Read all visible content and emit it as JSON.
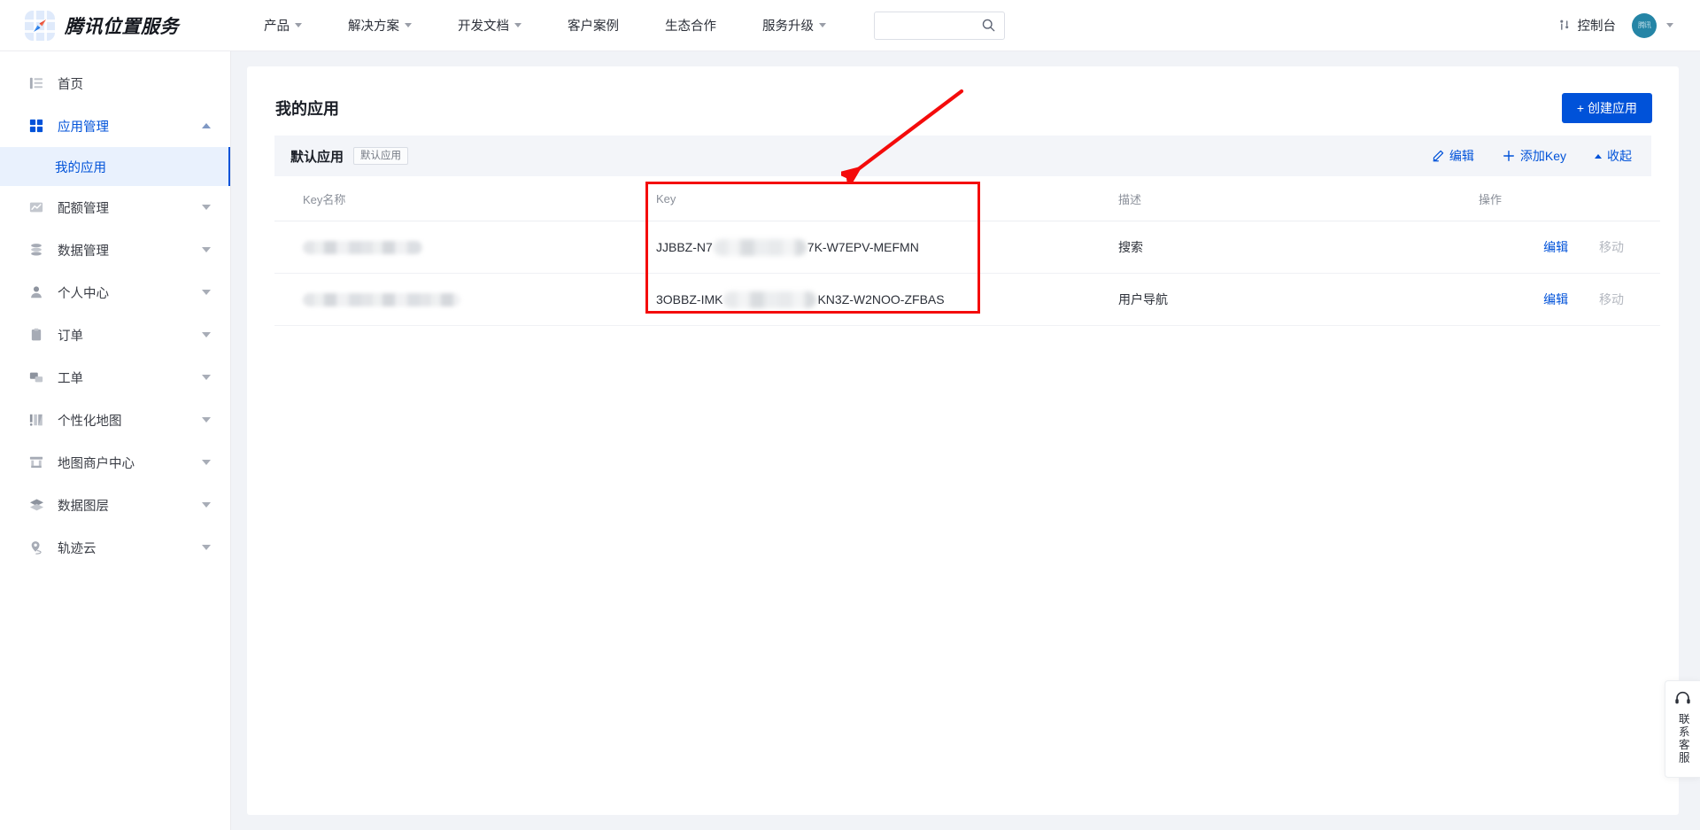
{
  "header": {
    "brand_name": "腾讯位置服务",
    "nav_items": [
      {
        "label": "产品",
        "has_dropdown": true
      },
      {
        "label": "解决方案",
        "has_dropdown": true
      },
      {
        "label": "开发文档",
        "has_dropdown": true
      },
      {
        "label": "客户案例",
        "has_dropdown": false
      },
      {
        "label": "生态合作",
        "has_dropdown": false
      },
      {
        "label": "服务升级",
        "has_dropdown": true
      }
    ],
    "search": {
      "value": "",
      "placeholder": ""
    },
    "console_label": "控制台",
    "avatar_text": "腾讯"
  },
  "sidebar": {
    "items": [
      {
        "label": "首页",
        "icon": "home-list-icon",
        "expandable": false,
        "active": false
      },
      {
        "label": "应用管理",
        "icon": "grid-icon",
        "expandable": true,
        "expanded": true,
        "active": true
      },
      {
        "label": "配额管理",
        "icon": "chart-wave-icon",
        "expandable": true,
        "expanded": false,
        "active": false
      },
      {
        "label": "数据管理",
        "icon": "database-icon",
        "expandable": true,
        "expanded": false,
        "active": false
      },
      {
        "label": "个人中心",
        "icon": "user-icon",
        "expandable": true,
        "expanded": false,
        "active": false
      },
      {
        "label": "订单",
        "icon": "clipboard-icon",
        "expandable": true,
        "expanded": false,
        "active": false
      },
      {
        "label": "工单",
        "icon": "ticket-icon",
        "expandable": true,
        "expanded": false,
        "active": false
      },
      {
        "label": "个性化地图",
        "icon": "map-style-icon",
        "expandable": true,
        "expanded": false,
        "active": false
      },
      {
        "label": "地图商户中心",
        "icon": "store-icon",
        "expandable": true,
        "expanded": false,
        "active": false
      },
      {
        "label": "数据图层",
        "icon": "layers-icon",
        "expandable": true,
        "expanded": false,
        "active": false
      },
      {
        "label": "轨迹云",
        "icon": "location-track-icon",
        "expandable": true,
        "expanded": false,
        "active": false
      }
    ],
    "submenu": {
      "label": "我的应用",
      "active": true
    }
  },
  "main": {
    "page_title": "我的应用",
    "create_button": "创建应用",
    "create_button_prefix": "+",
    "group": {
      "name": "默认应用",
      "tag": "默认应用",
      "actions": [
        {
          "label": "编辑",
          "icon": "pencil-icon"
        },
        {
          "label": "添加Key",
          "icon": "plus-icon"
        },
        {
          "label": "收起",
          "icon": "caret-up-icon"
        }
      ]
    },
    "table": {
      "columns": [
        "Key名称",
        "Key",
        "描述",
        "操作"
      ],
      "rows": [
        {
          "key_name": "",
          "key_name_redacted": true,
          "key_prefix": "JJBBZ-N7",
          "key_redacted": true,
          "key_suffix": "7K-W7EPV-MEFMN",
          "description": "搜索",
          "ops": [
            "编辑",
            "移动"
          ]
        },
        {
          "key_name": "",
          "key_name_redacted": true,
          "key_prefix": "3OBBZ-IMK",
          "key_redacted": true,
          "key_suffix": "KN3Z-W2NOO-ZFBAS",
          "description": "用户导航",
          "ops": [
            "编辑",
            "移动"
          ]
        }
      ]
    }
  },
  "customer_service": {
    "label": "联系客服",
    "icon": "headset-icon"
  },
  "annotations": {
    "highlight_box": {
      "color": "#f40b0b"
    },
    "arrow": {
      "color": "#f40b0b"
    }
  },
  "colors": {
    "accent": "#0052d9",
    "page_bg": "#f1f3f7",
    "annotation_red": "#f40b0b",
    "avatar_bg": "#2585a6"
  }
}
